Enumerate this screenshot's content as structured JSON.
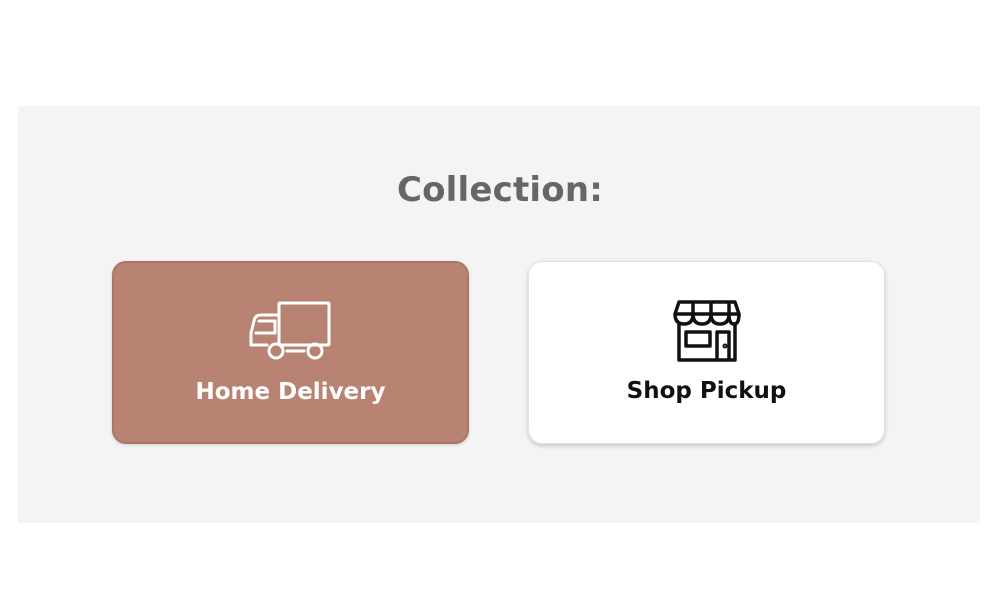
{
  "collection": {
    "title": "Collection:",
    "options": [
      {
        "label": "Home Delivery",
        "icon": "truck-icon",
        "selected": true,
        "color": "#b98373"
      },
      {
        "label": "Shop Pickup",
        "icon": "shop-icon",
        "selected": false,
        "color": "#ffffff"
      }
    ]
  }
}
